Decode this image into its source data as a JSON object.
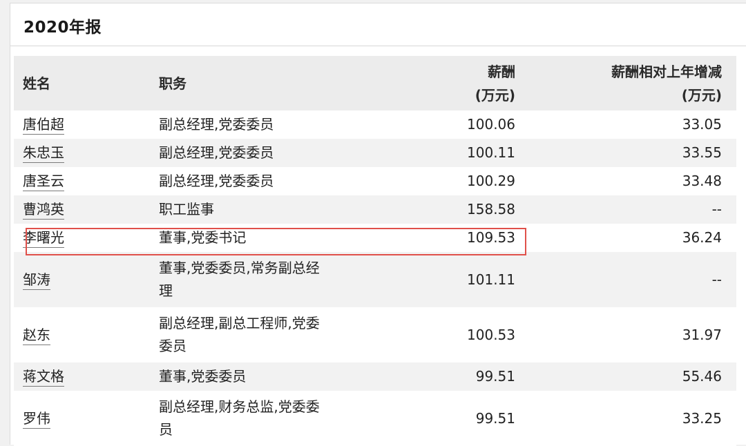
{
  "title": "2020年报",
  "table": {
    "headers": {
      "name": "姓名",
      "role": "职务",
      "salary_line1": "薪酬",
      "salary_line2": "(万元)",
      "change_line1": "薪酬相对上年增减",
      "change_line2": "(万元)"
    },
    "rows": [
      {
        "name": "唐伯超",
        "role_line1": "副总经理,党委委员",
        "role_line2": "",
        "salary": "100.06",
        "change": "33.05"
      },
      {
        "name": "朱忠玉",
        "role_line1": "副总经理,党委委员",
        "role_line2": "",
        "salary": "100.11",
        "change": "33.55"
      },
      {
        "name": "唐圣云",
        "role_line1": "副总经理,党委委员",
        "role_line2": "",
        "salary": "100.29",
        "change": "33.48"
      },
      {
        "name": "曹鸿英",
        "role_line1": "职工监事",
        "role_line2": "",
        "salary": "158.58",
        "change": "--"
      },
      {
        "name": "李曙光",
        "role_line1": "董事,党委书记",
        "role_line2": "",
        "salary": "109.53",
        "change": "36.24"
      },
      {
        "name": "邹涛",
        "role_line1": "董事,党委委员,常务副总经",
        "role_line2": "理",
        "salary": "101.11",
        "change": "--"
      },
      {
        "name": "赵东",
        "role_line1": "副总经理,副总工程师,党委",
        "role_line2": "委员",
        "salary": "100.53",
        "change": "31.97"
      },
      {
        "name": "蒋文格",
        "role_line1": "董事,党委委员",
        "role_line2": "",
        "salary": "99.51",
        "change": "55.46"
      },
      {
        "name": "罗伟",
        "role_line1": "副总经理,财务总监,党委委",
        "role_line2": "员",
        "salary": "99.51",
        "change": "33.25"
      }
    ]
  },
  "highlight": {
    "row": "李曙光",
    "color": "#e0504a"
  },
  "colors": {
    "header_bg": "#ececec",
    "stripe_bg": "#f2f2f2",
    "page_bg": "#f1f1f1"
  }
}
